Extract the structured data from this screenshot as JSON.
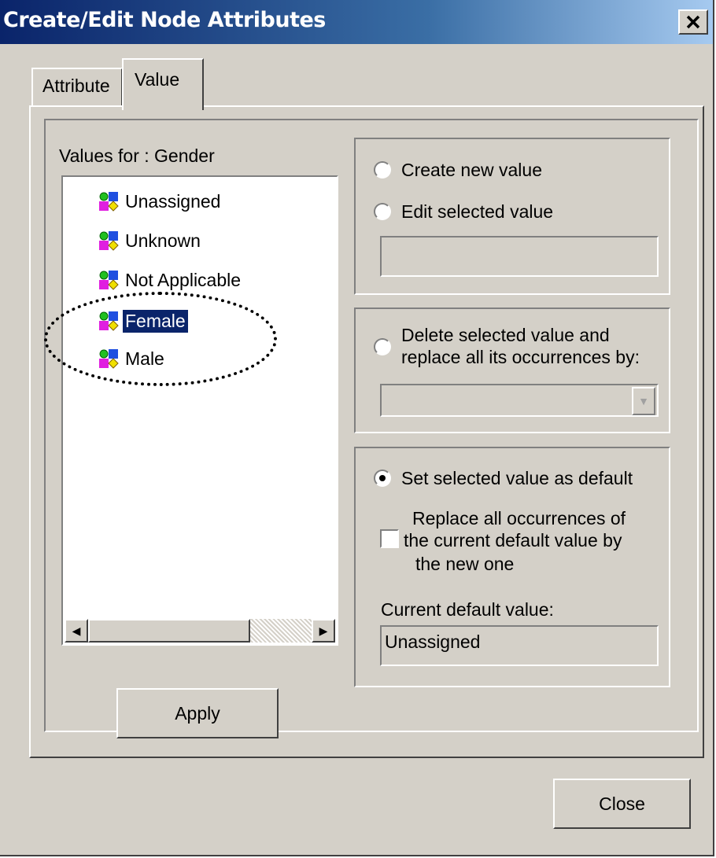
{
  "window": {
    "title": "Create/Edit Node Attributes",
    "close_glyph": "✕"
  },
  "tabs": [
    {
      "label": "Attribute",
      "active": false
    },
    {
      "label": "Value",
      "active": true
    }
  ],
  "values_panel": {
    "heading": "Values for : Gender",
    "items": [
      {
        "label": "Unassigned",
        "icon": "node-value-icon",
        "selected": false
      },
      {
        "label": "Unknown",
        "icon": "node-value-icon",
        "selected": false
      },
      {
        "label": "Not Applicable",
        "icon": "node-value-icon",
        "selected": false
      },
      {
        "label": "Female",
        "icon": "node-value-icon",
        "selected": true
      },
      {
        "label": "Male",
        "icon": "node-value-icon",
        "selected": false
      }
    ],
    "scroll_left_glyph": "◀",
    "scroll_right_glyph": "▶"
  },
  "edit_group": {
    "create_label": "Create new value",
    "edit_label": "Edit selected value",
    "value_field": ""
  },
  "delete_group": {
    "label_line1": "Delete selected value and",
    "label_line2": "replace all its occurrences by:",
    "replacement_value": "",
    "dropdown_glyph": "▼"
  },
  "default_group": {
    "set_default_label": "Set selected value as default",
    "set_default_checked": true,
    "replace_line1": "Replace all occurrences of",
    "replace_line2": "the current default value by",
    "replace_line3": "the new one",
    "replace_checked": false,
    "current_default_label": "Current default value:",
    "current_default_value": "Unassigned"
  },
  "buttons": {
    "apply": "Apply",
    "close": "Close"
  },
  "colors": {
    "dialog_bg": "#d4d0c8",
    "titlebar_start": "#0a246a",
    "titlebar_end": "#a6caf0",
    "selection": "#0a246a"
  }
}
